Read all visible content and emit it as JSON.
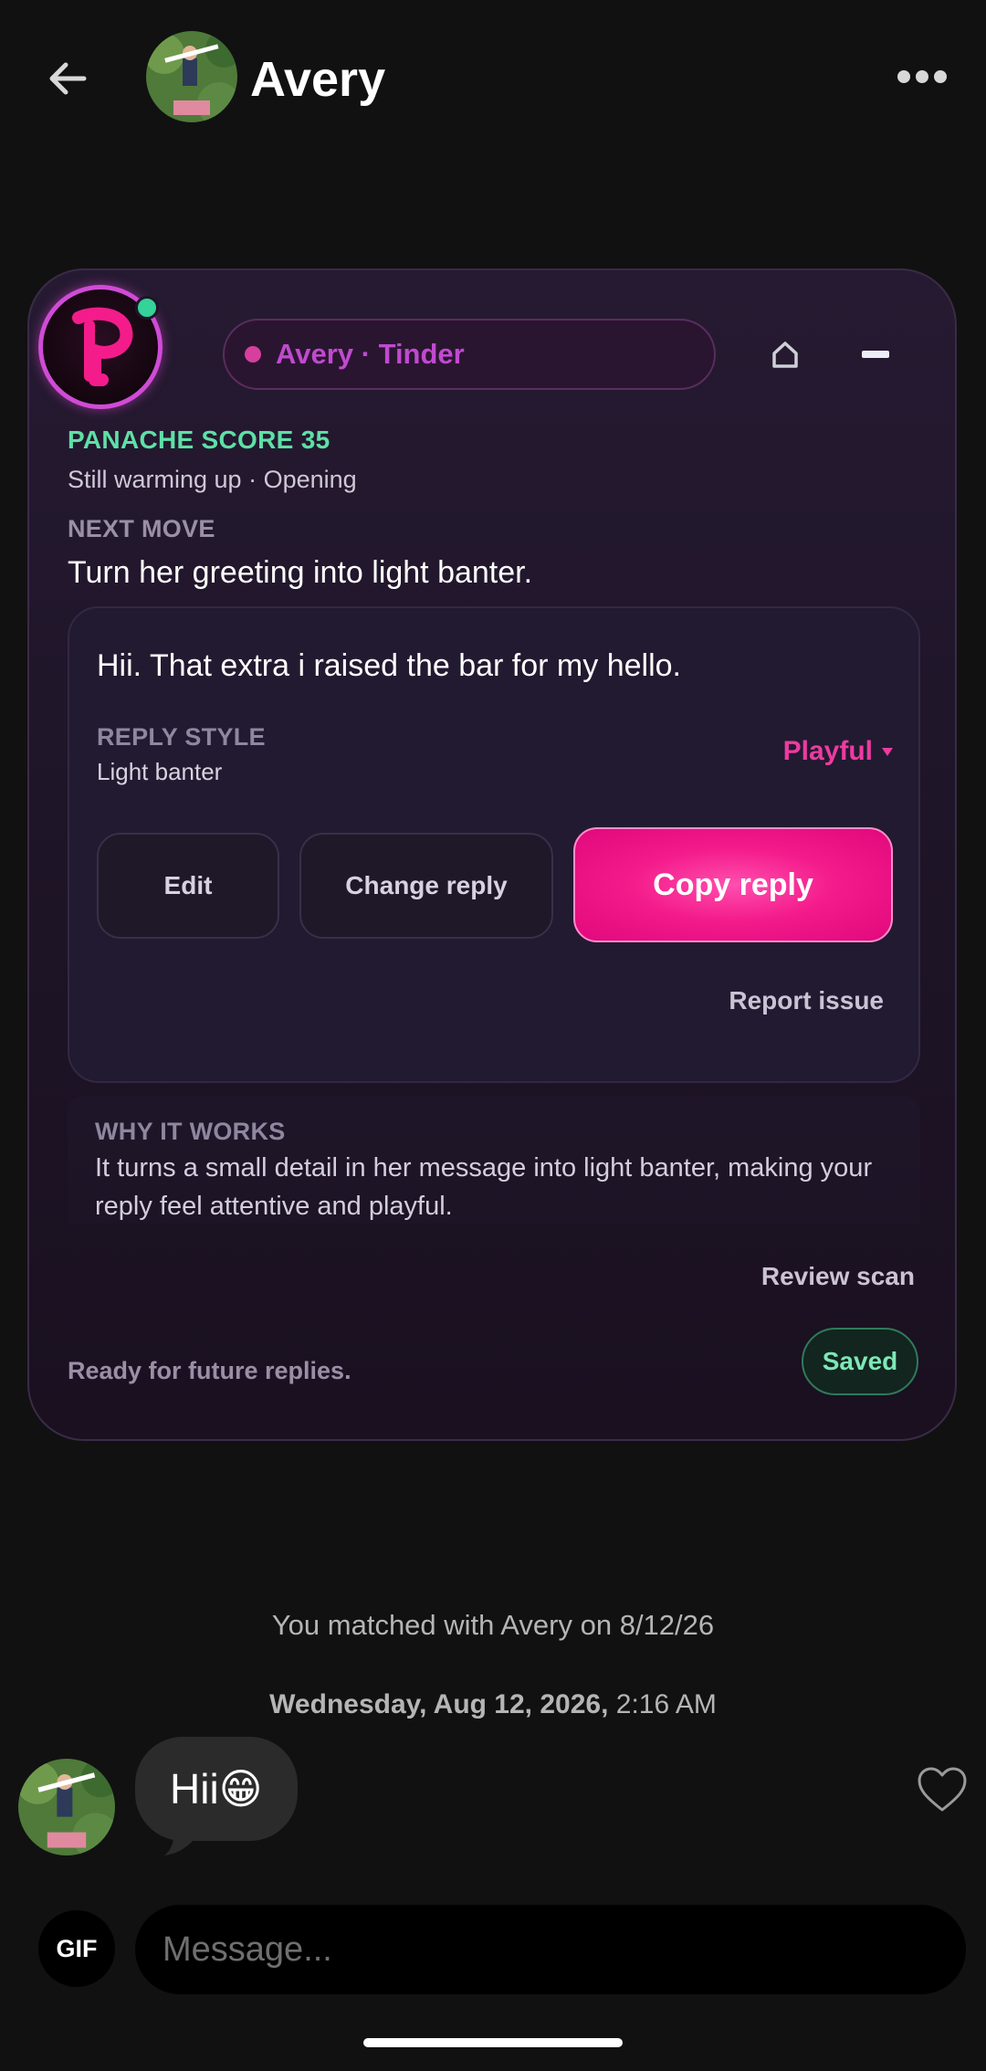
{
  "header": {
    "name": "Avery",
    "icons": {
      "back": "arrow-left-icon",
      "more": "ellipsis-icon"
    }
  },
  "assistant": {
    "logo_letter": "P",
    "source": "Avery · Tinder",
    "score_label": "PANACHE SCORE 35",
    "score_sub": "Still warming up · Opening",
    "next_move_label": "NEXT MOVE",
    "next_move": "Turn her greeting into light banter.",
    "reply": {
      "text": "Hii. That extra i raised the bar for my hello.",
      "style_label": "REPLY STYLE",
      "style_value": "Light banter",
      "style_select": "Playful",
      "edit_label": "Edit",
      "change_label": "Change reply",
      "copy_label": "Copy reply",
      "report_label": "Report issue"
    },
    "why": {
      "label": "WHY IT WORKS",
      "text": "It turns a small detail in her message into light banter, making your reply feel attentive and playful."
    },
    "review_label": "Review scan",
    "ready_text": "Ready for future replies.",
    "saved_label": "Saved",
    "colors": {
      "accent": "#f41c8b",
      "score": "#5ee0a6",
      "online": "#34d399"
    }
  },
  "chat": {
    "match_text": "You matched with Avery on 8/12/26",
    "date_bold": "Wednesday, Aug 12, 2026,",
    "date_time": " 2:16 AM",
    "message": "Hii😁"
  },
  "composer": {
    "gif_label": "GIF",
    "placeholder": "Message..."
  }
}
